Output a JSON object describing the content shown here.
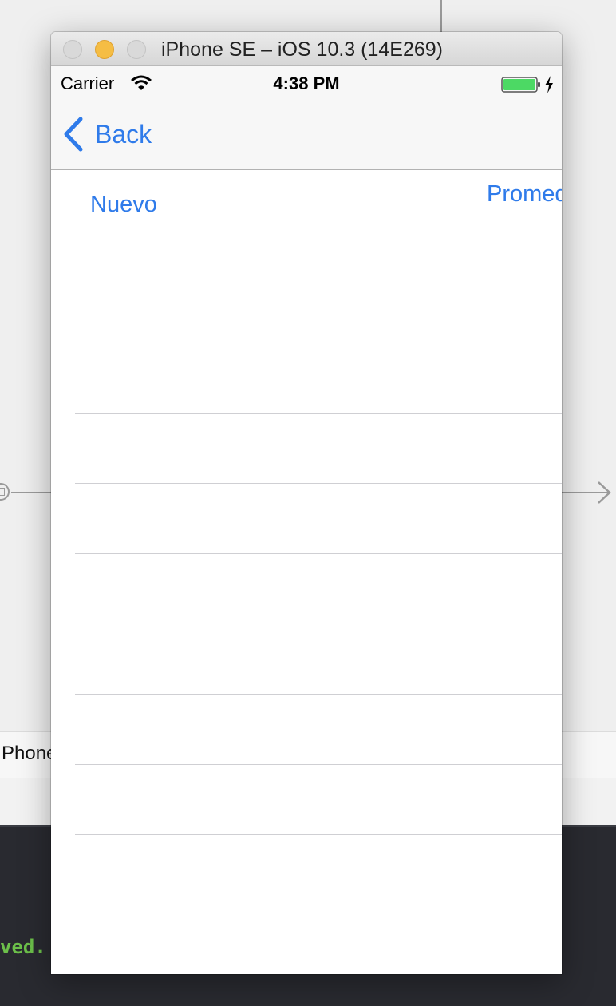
{
  "simulator": {
    "window_title": "iPhone SE – iOS 10.3 (14E269)"
  },
  "status_bar": {
    "carrier": "Carrier",
    "time": "4:38 PM",
    "battery_color": "#4cd964"
  },
  "nav_bar": {
    "back_label": "Back"
  },
  "content": {
    "new_button": "Nuevo",
    "average_button_visible": "Promed"
  },
  "background": {
    "device_label": "Phone",
    "console_text": "ved."
  },
  "theme": {
    "tint": "#2f7bea"
  }
}
